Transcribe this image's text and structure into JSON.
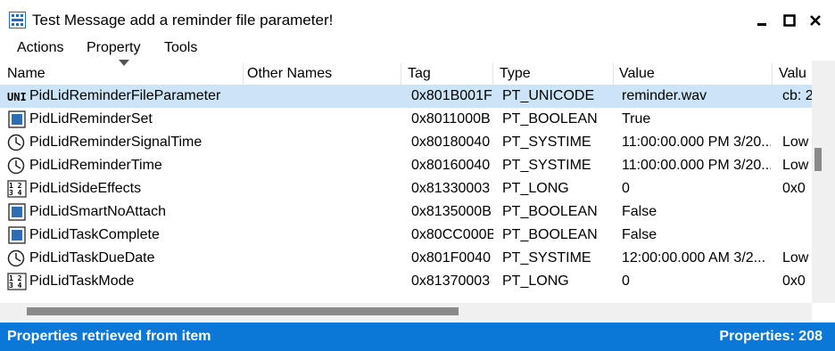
{
  "window": {
    "title": "Test Message add a reminder file parameter!",
    "icon": "mapi-app-icon",
    "controls": [
      "minimize-icon",
      "maximize-icon",
      "close-icon"
    ]
  },
  "menu": {
    "items": [
      "Actions",
      "Property",
      "Tools"
    ]
  },
  "table": {
    "columns": [
      "Name",
      "Other Names",
      "Tag",
      "Type",
      "Value",
      "Valu"
    ],
    "rows": [
      {
        "icon": "unicode-string-icon",
        "name": "PidLidReminderFileParameter",
        "other": "",
        "tag": "0x801B001F",
        "type": "PT_UNICODE",
        "value": "reminder.wav",
        "value2": "cb: 2",
        "selected": true
      },
      {
        "icon": "boolean-icon",
        "name": "PidLidReminderSet",
        "other": "",
        "tag": "0x8011000B",
        "type": "PT_BOOLEAN",
        "value": "True",
        "value2": "",
        "selected": false
      },
      {
        "icon": "clock-icon",
        "name": "PidLidReminderSignalTime",
        "other": "",
        "tag": "0x80180040",
        "type": "PT_SYSTIME",
        "value": "11:00:00.000 PM 3/20...",
        "value2": "Low",
        "selected": false
      },
      {
        "icon": "clock-icon",
        "name": "PidLidReminderTime",
        "other": "",
        "tag": "0x80160040",
        "type": "PT_SYSTIME",
        "value": "11:00:00.000 PM 3/20...",
        "value2": "Low",
        "selected": false
      },
      {
        "icon": "number-icon",
        "name": "PidLidSideEffects",
        "other": "",
        "tag": "0x81330003",
        "type": "PT_LONG",
        "value": "0",
        "value2": "0x0",
        "selected": false
      },
      {
        "icon": "boolean-icon",
        "name": "PidLidSmartNoAttach",
        "other": "",
        "tag": "0x8135000B",
        "type": "PT_BOOLEAN",
        "value": "False",
        "value2": "",
        "selected": false
      },
      {
        "icon": "boolean-icon",
        "name": "PidLidTaskComplete",
        "other": "",
        "tag": "0x80CC000B",
        "type": "PT_BOOLEAN",
        "value": "False",
        "value2": "",
        "selected": false
      },
      {
        "icon": "clock-icon",
        "name": "PidLidTaskDueDate",
        "other": "",
        "tag": "0x801F0040",
        "type": "PT_SYSTIME",
        "value": "12:00:00.000 AM 3/2...",
        "value2": "Low",
        "selected": false
      },
      {
        "icon": "number-icon",
        "name": "PidLidTaskMode",
        "other": "",
        "tag": "0x81370003",
        "type": "PT_LONG",
        "value": "0",
        "value2": "0x0",
        "selected": false
      }
    ]
  },
  "status": {
    "left": "Properties retrieved from item",
    "right": "Properties: 208"
  },
  "colors": {
    "statusbar": "#0b78d7",
    "selection": "#cce4f7",
    "boolean": "#2e6db4"
  }
}
